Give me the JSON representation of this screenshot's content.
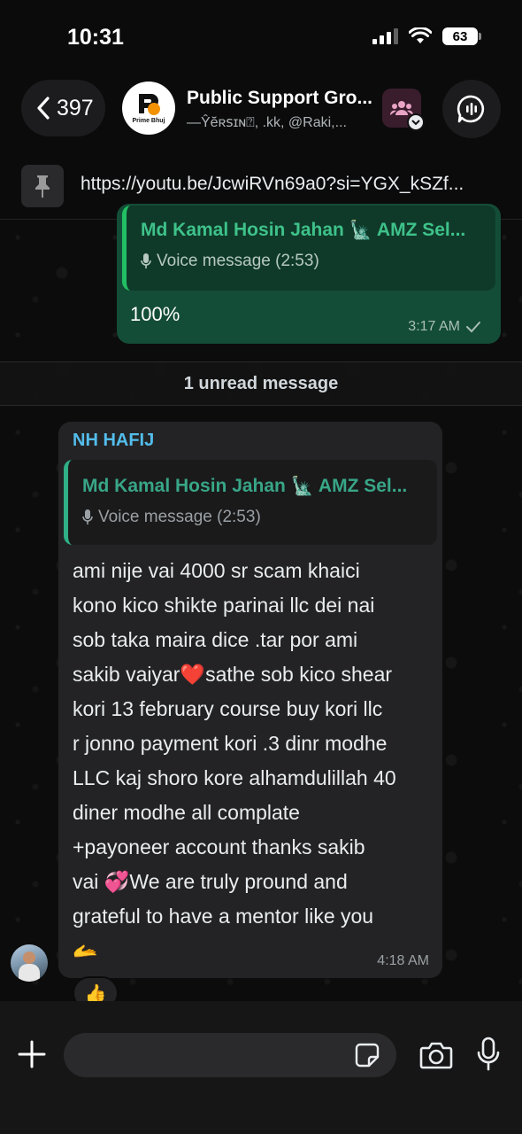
{
  "status_bar": {
    "time": "10:31",
    "battery": "63"
  },
  "header": {
    "back_count": "397",
    "group_name": "Public Support Gro...",
    "members_preview": "—Ŷĕʀꜱɪɴ⍰, .kk, @Raki,...",
    "avatar_text": "Prime Bhuj"
  },
  "pinned": {
    "link": "https://youtu.be/JcwiRVn69a0?si=YGX_kSZf..."
  },
  "outgoing": {
    "quote_name": "Md Kamal Hosin Jahan 🗽 AMZ Sel...",
    "quote_voice": "Voice message (2:53)",
    "text": "100%",
    "time": "3:17 AM"
  },
  "divider": {
    "label": "1 unread message"
  },
  "incoming": {
    "sender": "NH HAFIJ",
    "quote_name": "Md Kamal Hosin Jahan 🗽 AMZ Sel...",
    "quote_voice": "Voice message (2:53)",
    "lines": [
      "ami nije vai 4000 sr scam khaici",
      "kono kico shikte parinai llc dei nai",
      "sob taka maira dice .tar por ami",
      "sakib vaiyar❤️sathe sob kico shear",
      "kori 13 february course buy kori  llc",
      "r jonno payment kori .3 dinr modhe",
      "LLC kaj shoro kore alhamdulillah 40",
      "diner modhe all complate",
      "+payoneer account thanks sakib",
      "vai 💞We are truly pround and",
      "grateful to have a mentor like you",
      "🫴"
    ],
    "time": "4:18 AM",
    "reaction": "👍"
  },
  "composer": {
    "placeholder": ""
  },
  "icons": {
    "back": "chevron-left-icon",
    "community": "community-icon",
    "call": "group-call-icon",
    "pin": "pin-icon",
    "plus": "plus-icon",
    "sticker": "sticker-icon",
    "camera": "camera-icon",
    "mic": "mic-icon",
    "voice": "mic-small-icon",
    "read": "check-icon"
  },
  "colors": {
    "outgoing_bubble": "#144d37",
    "incoming_bubble": "#232325",
    "sender_name": "#53bdeb",
    "quote_accent": "#21c063"
  }
}
